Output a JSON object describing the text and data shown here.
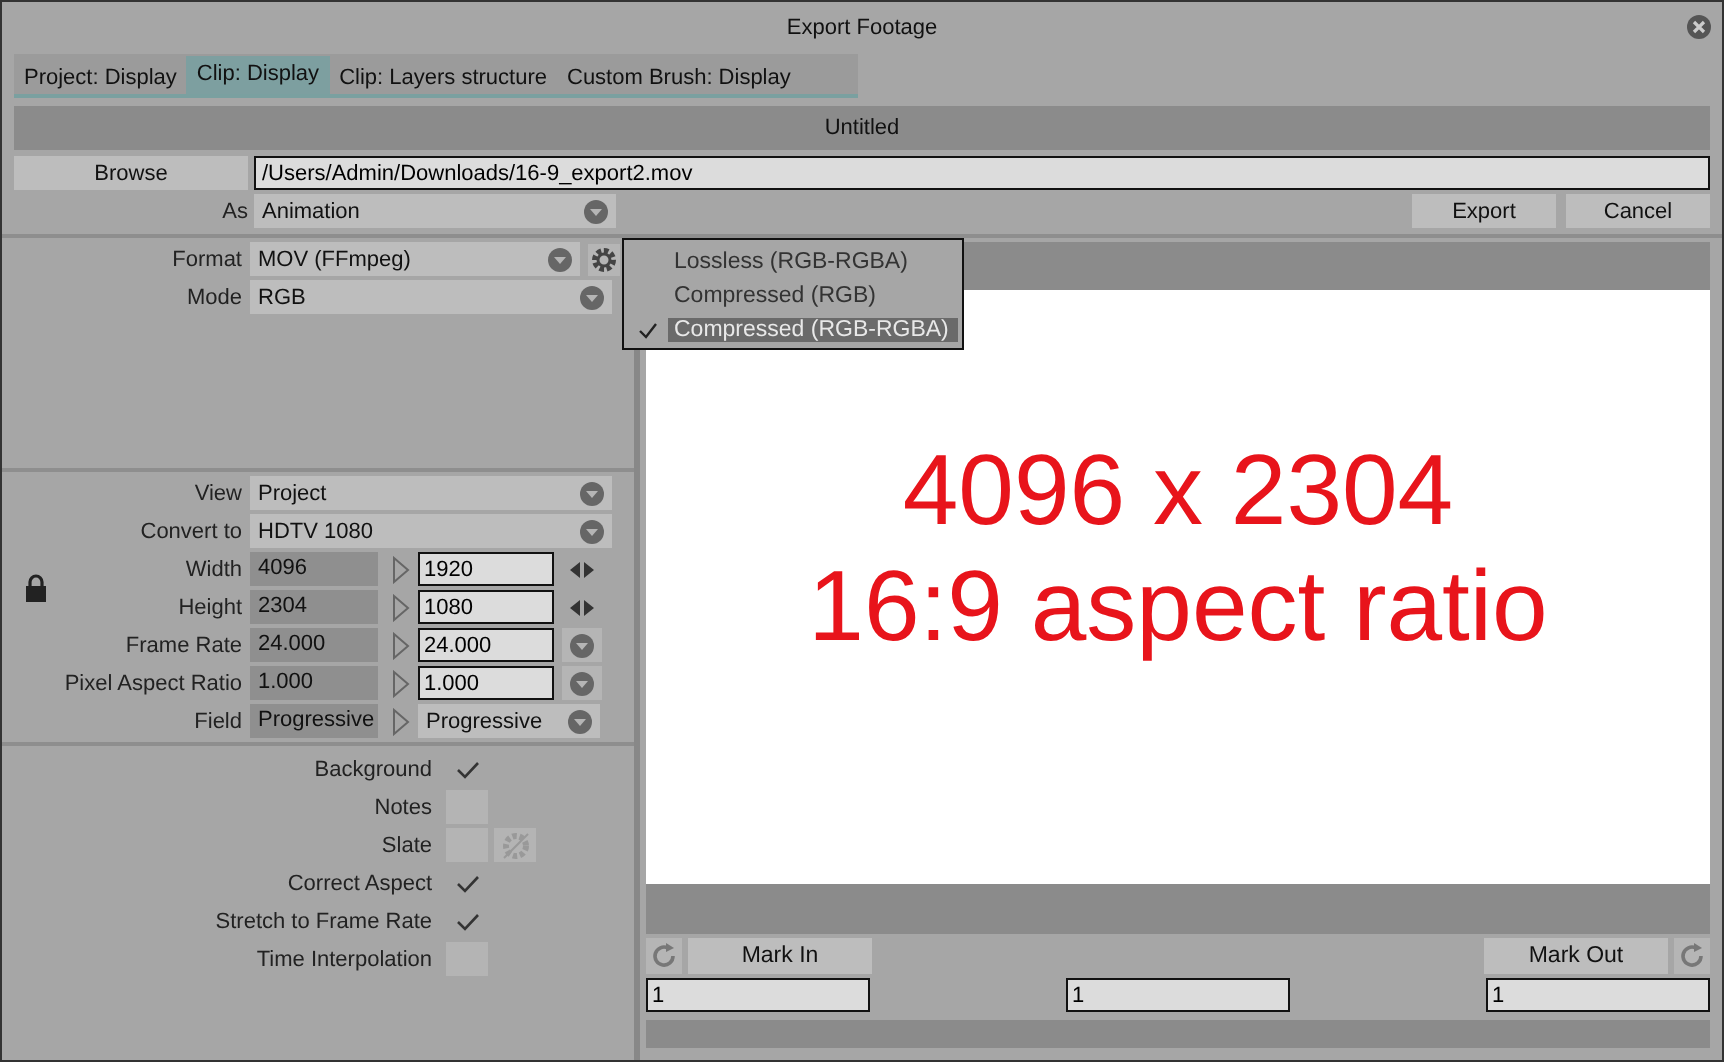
{
  "window": {
    "title": "Export Footage"
  },
  "tabs": [
    {
      "label": "Project: Display",
      "selected": false
    },
    {
      "label": "Clip: Display",
      "selected": true
    },
    {
      "label": "Clip: Layers structure",
      "selected": false
    },
    {
      "label": "Custom Brush: Display",
      "selected": false
    }
  ],
  "header": "Untitled",
  "browse": {
    "button": "Browse",
    "path": "/Users/Admin/Downloads/16-9_export2.mov"
  },
  "as": {
    "label": "As",
    "value": "Animation"
  },
  "buttons": [
    "Export",
    "Cancel"
  ],
  "format_rows": [
    {
      "label": "Format",
      "value": "MOV (FFmpeg)",
      "settings": true
    },
    {
      "label": "Mode",
      "value": "RGB",
      "settings": false
    }
  ],
  "dropdown_menu": [
    {
      "label": "Lossless (RGB-RGBA)",
      "selected": false
    },
    {
      "label": "Compressed (RGB)",
      "selected": false
    },
    {
      "label": "Compressed (RGB-RGBA)",
      "selected": true
    }
  ],
  "conversion_rows": [
    {
      "kind": "select",
      "label": "View",
      "value": "Project"
    },
    {
      "kind": "select",
      "label": "Convert to",
      "value": "HDTV 1080"
    },
    {
      "kind": "stepper",
      "label": "Width",
      "source": "4096",
      "target": "1920"
    },
    {
      "kind": "stepper",
      "label": "Height",
      "source": "2304",
      "target": "1080"
    },
    {
      "kind": "dropdown",
      "label": "Frame Rate",
      "source": "24.000",
      "target": "24.000"
    },
    {
      "kind": "dropdown",
      "label": "Pixel Aspect Ratio",
      "source": "1.000",
      "target": "1.000"
    },
    {
      "kind": "choice",
      "label": "Field",
      "source": "Progressive",
      "target": "Progressive"
    }
  ],
  "options": [
    {
      "label": "Background",
      "checked": true,
      "settings": false
    },
    {
      "label": "Notes",
      "checked": false,
      "settings": false
    },
    {
      "label": "Slate",
      "checked": false,
      "settings": true
    },
    {
      "label": "Correct Aspect",
      "checked": true,
      "settings": false
    },
    {
      "label": "Stretch to Frame Rate",
      "checked": true,
      "settings": false
    },
    {
      "label": "Time Interpolation",
      "checked": false,
      "settings": false
    }
  ],
  "preview": {
    "lines": [
      "4096 x 2304",
      "16:9 aspect ratio"
    ]
  },
  "mark_in": "Mark In",
  "mark_out": "Mark Out",
  "frame_fields": [
    "1",
    "1",
    "1"
  ]
}
